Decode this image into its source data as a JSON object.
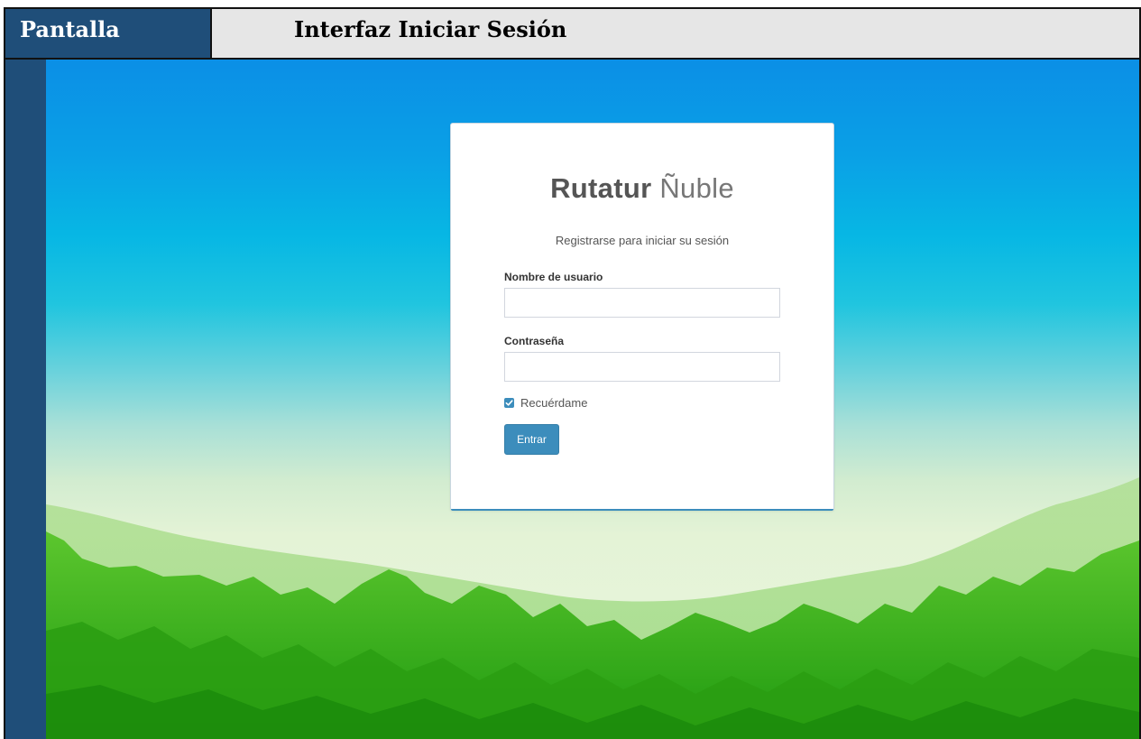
{
  "header": {
    "left_label": "Pantalla",
    "title": "Interfaz Iniciar Sesión"
  },
  "login": {
    "brand_bold": "Rutatur",
    "brand_light": "Ñuble",
    "subtitle": "Registrarse para iniciar su sesión",
    "username_label": "Nombre de usuario",
    "username_value": "",
    "password_label": "Contraseña",
    "password_value": "",
    "remember_label": "Recuérdame",
    "remember_checked": true,
    "submit_label": "Entrar"
  },
  "colors": {
    "header_blue": "#1f4e79",
    "header_gray": "#e6e6e6",
    "accent": "#3c8dbc",
    "sky_top": "#0b8fe6",
    "grass": "#2ea516"
  }
}
